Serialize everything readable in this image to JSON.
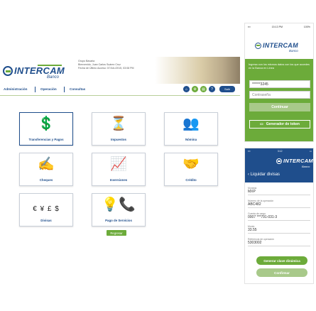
{
  "desktop": {
    "brand": "INTERCAM",
    "brand_sub": "Banco",
    "info_lines": [
      "Grupo Bavaria",
      "Bienvenido, Juan Carlos Suárez Cruz",
      "Fecha de Último Acceso: 07/JUL/2015, 03:08 PM"
    ],
    "nav": [
      "Administración",
      "Operación",
      "Consultas"
    ],
    "exit_label": "Salir",
    "tiles": [
      {
        "label": "Transferencias y Pagos",
        "icon": "hand-dollar-icon",
        "glyph": "💲"
      },
      {
        "label": "Impuestos",
        "icon": "funnel-dollar-icon",
        "glyph": "⏳"
      },
      {
        "label": "Nómina",
        "icon": "payroll-icon",
        "glyph": "👥"
      },
      {
        "label": "Cheques",
        "icon": "cheque-icon",
        "glyph": "✍"
      },
      {
        "label": "Inversiones",
        "icon": "investment-chart-icon",
        "glyph": "📈"
      },
      {
        "label": "Crédito",
        "icon": "credit-hand-icon",
        "glyph": "🤝"
      },
      {
        "label": "Divisas",
        "icon": "currency-icon",
        "glyph": "€ ¥ £ $"
      },
      {
        "label": "Pago de Servicios",
        "icon": "utilities-icon",
        "glyph": "💡📞"
      }
    ],
    "back_label": "Regresar"
  },
  "phone1": {
    "time": "15:13 PM",
    "battery": "100%",
    "brand": "INTERCAM",
    "brand_sub": "Banco",
    "intro": "Ingresa con los mismos datos con los que accedes en la Banca en Línea",
    "user_value": "******3245",
    "password_placeholder": "Contraseña",
    "continue_label": "Continuar",
    "token_label": "Generador de token"
  },
  "phone2": {
    "time": "3:12",
    "brand": "INTERCAM",
    "brand_sub": "Banco",
    "title": "Liquidar divisas",
    "fields": [
      {
        "label": "Moneda",
        "value": "MXP"
      },
      {
        "label": "Número de la operación",
        "value": "ABC482"
      },
      {
        "label": "Cuenta de cargo",
        "value": "0007 ***791-031-3"
      },
      {
        "label": "Monto",
        "value": "33.55"
      },
      {
        "label": "Referencia de operación",
        "value": "5303002"
      }
    ],
    "generate_label": "Generar clave dinámica",
    "confirm_label": "Confirmar"
  },
  "colors": {
    "brand_blue": "#1f4e8c",
    "brand_green": "#6cab3a"
  }
}
